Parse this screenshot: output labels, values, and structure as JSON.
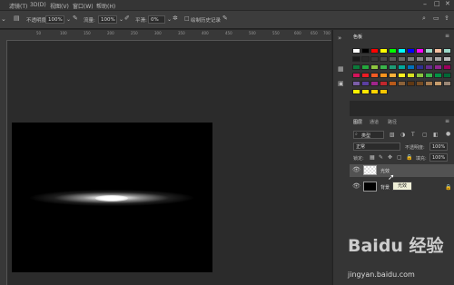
{
  "menu": {
    "items": [
      "滤镜(T)",
      "3D(D)",
      "视图(V)",
      "窗口(W)",
      "帮助(H)"
    ]
  },
  "options": {
    "opacity_label": "不透明度:",
    "opacity_value": "100%",
    "flow_label": "流量:",
    "flow_value": "100%",
    "smoothing_label": "平滑:",
    "smoothing_value": "0%",
    "history_label": "绘制历史记录"
  },
  "ruler": {
    "ticks": [
      "50",
      "100",
      "150",
      "200",
      "250",
      "300",
      "350",
      "400",
      "450",
      "500",
      "550",
      "600",
      "650",
      "700"
    ]
  },
  "swatches_panel": {
    "tab_label": "色板",
    "rows": [
      [
        "#ffffff",
        "#000000",
        "#ff0000",
        "#ffff00",
        "#00ff00",
        "#00ffff",
        "#0000ff",
        "#ff00ff",
        "#9bd8c8",
        "#f5c0a0",
        "#9bd8c8"
      ],
      [
        "#1a1a1a",
        "#2a2a2a",
        "#3a3a3a",
        "#4a4a4a",
        "#5a5a5a",
        "#6a6a6a",
        "#7a7a7a",
        "#8a8a8a",
        "#9a9a9a",
        "#aaaaaa",
        "#bbbbbb"
      ],
      [
        "#0b7a3a",
        "#24a83d",
        "#8dc63f",
        "#39b54a",
        "#1d9b75",
        "#00a99d",
        "#0071bc",
        "#2e3192",
        "#662d91",
        "#92278f",
        "#9e005d"
      ],
      [
        "#d4145a",
        "#ed1c24",
        "#f15a24",
        "#f7931e",
        "#fbb03b",
        "#fcee21",
        "#d9e021",
        "#8cc63f",
        "#39b54a",
        "#009245",
        "#006837"
      ],
      [
        "#7b5ea7",
        "#5b3fa0",
        "#a0268c",
        "#c1272d",
        "#b85a1a",
        "#8c6239",
        "#603813",
        "#754c24",
        "#a67c52",
        "#c69c6d",
        "#998675"
      ],
      [
        "#fff200",
        "#ffe600",
        "#ffd200",
        "#f7c600"
      ]
    ]
  },
  "layers_panel": {
    "tabs": [
      "图层",
      "通道",
      "路径"
    ],
    "filter_label": "类型",
    "blend_mode": "正常",
    "opacity_label": "不透明度:",
    "opacity_value": "100%",
    "lock_label": "锁定:",
    "fill_label": "填充:",
    "fill_value": "100%",
    "layers": [
      {
        "name": "光效",
        "selected": true,
        "thumb": "transparent"
      },
      {
        "name": "背景",
        "selected": false,
        "thumb": "black"
      }
    ],
    "tooltip": "光效"
  },
  "watermark": {
    "text": "Baidu 经验",
    "url": "jingyan.baidu.com"
  }
}
